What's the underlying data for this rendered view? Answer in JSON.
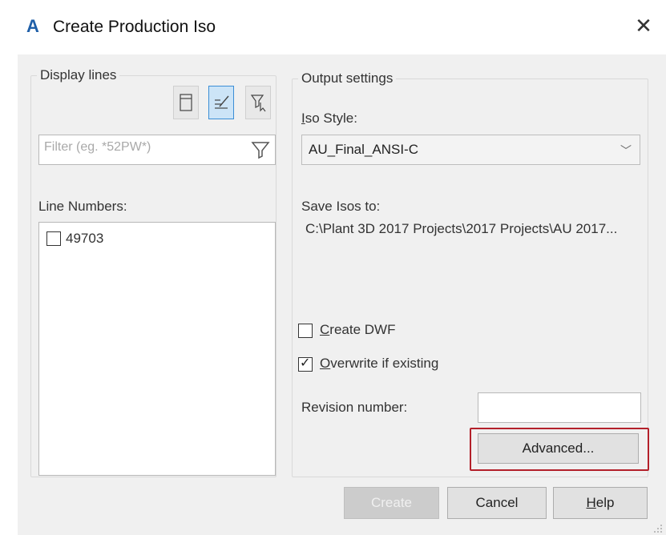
{
  "window": {
    "title": "Create Production Iso",
    "app_icon": "autocad-a-icon",
    "close_icon": "close-icon"
  },
  "display_lines": {
    "legend": "Display lines",
    "filter_placeholder": "Filter (eg. *52PW*)",
    "line_numbers_label": "Line Numbers:",
    "items": [
      {
        "label": "49703",
        "checked": false
      }
    ]
  },
  "output_settings": {
    "legend": "Output settings",
    "iso_style_label": "Iso Style:",
    "iso_style_value": "AU_Final_ANSI-C",
    "save_label": "Save Isos to:",
    "save_path": "C:\\Plant 3D 2017 Projects\\2017 Projects\\AU 2017...",
    "create_dwf_label": "Create DWF",
    "create_dwf_checked": false,
    "overwrite_label": "Overwrite if existing",
    "overwrite_checked": true,
    "revision_label": "Revision number:",
    "revision_value": "",
    "advanced_label": "Advanced...",
    "highlight_color": "#b3202a"
  },
  "footer": {
    "create_label": "Create",
    "cancel_label": "Cancel",
    "help_label": "Help"
  }
}
